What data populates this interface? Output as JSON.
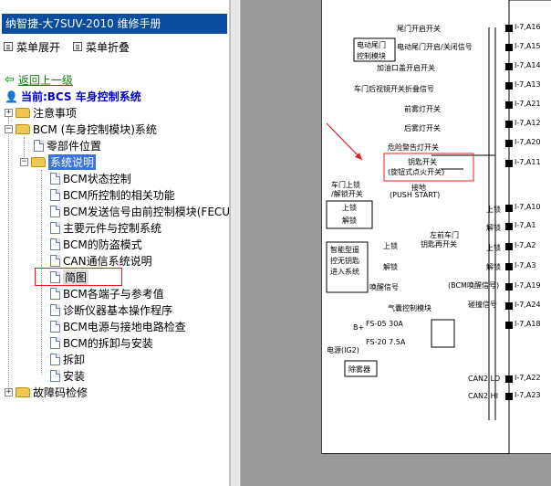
{
  "window": {
    "title": "纳智捷-大7SUV-2010 维修手册"
  },
  "toolbar": {
    "expand": "菜单展开",
    "collapse": "菜单折叠"
  },
  "nav": {
    "back": "返回上一级",
    "current": "当前:BCS 车身控制系统"
  },
  "tree": {
    "n1": "注意事项",
    "n2": "BCM (车身控制模块)系统",
    "n3": "零部件位置",
    "n4": "系统说明",
    "c1": "BCM状态控制",
    "c2": "BCM所控制的相关功能",
    "c3": "BCM发送信号由前控制模块(FECU)I",
    "c4": "主要元件与控制系统",
    "c5": "BCM的防盗模式",
    "c6": "CAN通信系统说明",
    "c7": "简图",
    "c8": "BCM各端子与参考值",
    "c9": "诊断仪器基本操作程序",
    "c10": "BCM电源与接地电路检查",
    "c11": "BCM的拆卸与安装",
    "c12": "拆卸",
    "c13": "安装",
    "n5": "故障码检修"
  },
  "diagram": {
    "l1": "尾门开启开关",
    "l2": "电动尾门",
    "l2b": "控制模块",
    "l3": "电动尾门开启/关闭信号",
    "l4": "加油口盖开启开关",
    "l5": "车门后视镜开关折叠信号",
    "l6": "前雾灯开关",
    "l7": "后雾灯开关",
    "l8": "危险警告灯开关",
    "l9": "钥匙开关",
    "l9b": "(旋钮式点火开关)",
    "l10": "接地",
    "l10b": "(PUSH START)",
    "l11": "车门上锁",
    "l11b": "/解锁开关",
    "l12": "上锁",
    "l13": "解锁",
    "l14": "左前车门",
    "l14b": "钥匙再开关",
    "l15": "智能型遥",
    "l15b": "控无钥匙",
    "l15c": "进入系统",
    "l16": "(BCM唤醒信号)",
    "l17": "唤醒信号",
    "l18": "气囊控制模块",
    "l19": "碰撞信号",
    "l20": "FS-05 30A",
    "l21": "FS-20 7.5A",
    "l22": "电源(IG2)",
    "l23": "除雾器",
    "l24": "CAN2 LO",
    "l25": "CAN2 HI",
    "bplus": "B+",
    "pins": [
      "I-7,A16",
      "I-7,A15",
      "I-7,A14",
      "I-7,A13",
      "I-7,A21",
      "I-7,A12",
      "I-7,A20",
      "I-7,A11",
      "I-7,A10",
      "I-7,A1",
      "I-7,A2",
      "I-7,A3",
      "I-7,A19",
      "I-7,A24",
      "I-7,A18",
      "I-7,A22",
      "I-7,A23"
    ]
  }
}
